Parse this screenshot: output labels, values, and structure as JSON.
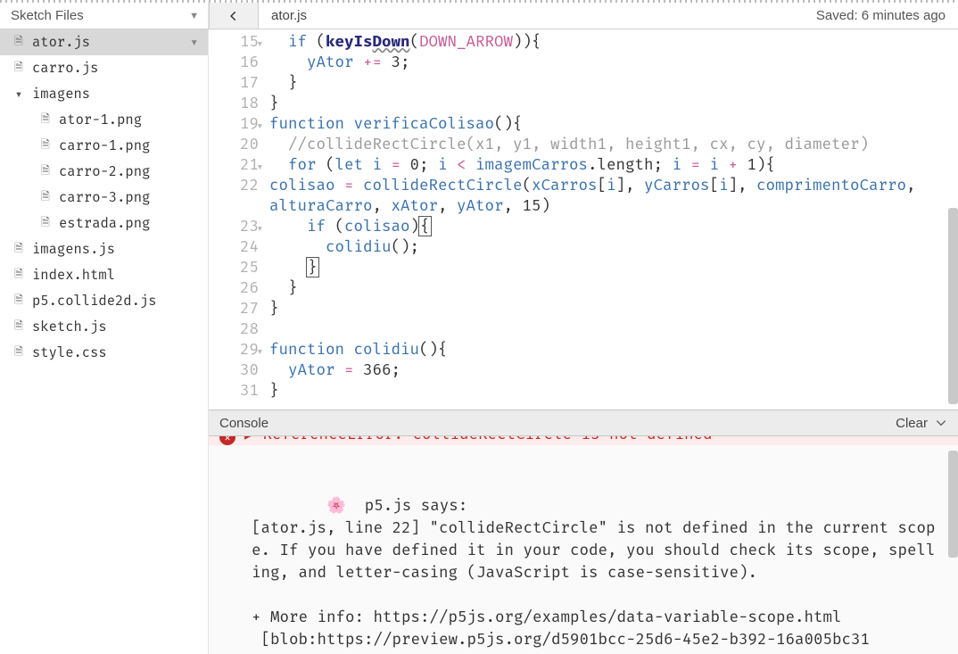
{
  "header": {
    "sketch_files_label": "Sketch Files",
    "current_tab": "ator.js",
    "saved_label": "Saved: 6 minutes ago"
  },
  "sidebar": {
    "files": [
      {
        "name": "ator.js",
        "type": "file",
        "indent": 0,
        "active": true,
        "chevron": true
      },
      {
        "name": "carro.js",
        "type": "file",
        "indent": 0
      },
      {
        "name": "imagens",
        "type": "folder-open",
        "indent": 0
      },
      {
        "name": "ator-1.png",
        "type": "file",
        "indent": 1
      },
      {
        "name": "carro-1.png",
        "type": "file",
        "indent": 1
      },
      {
        "name": "carro-2.png",
        "type": "file",
        "indent": 1
      },
      {
        "name": "carro-3.png",
        "type": "file",
        "indent": 1
      },
      {
        "name": "estrada.png",
        "type": "file",
        "indent": 1
      },
      {
        "name": "imagens.js",
        "type": "file",
        "indent": 0
      },
      {
        "name": "index.html",
        "type": "file",
        "indent": 0
      },
      {
        "name": "p5.collide2d.js",
        "type": "file",
        "indent": 0
      },
      {
        "name": "sketch.js",
        "type": "file",
        "indent": 0
      },
      {
        "name": "style.css",
        "type": "file",
        "indent": 0
      }
    ]
  },
  "editor": {
    "first_line": 15,
    "lines": [
      {
        "n": 15,
        "fold": true,
        "html": "  <span class='tok-kw'>if</span> (<span class='tok-bold'>keyIs</span><span class='tok-bold tok-under'>Down</span>(<span class='tok-pink'>DOWN_ARROW</span>)){"
      },
      {
        "n": 16,
        "html": "    <span class='tok-var'>yAtor</span> <span class='tok-op'>+=</span> <span class='tok-num'>3</span>;"
      },
      {
        "n": 17,
        "html": "  }"
      },
      {
        "n": 18,
        "html": "}"
      },
      {
        "n": 19,
        "fold": true,
        "html": "<span class='tok-kw'>function</span> <span class='tok-fn'>verificaColisao</span>(){"
      },
      {
        "n": 20,
        "html": "  <span class='tok-cmt'>//collideRectCircle(x1, y1, width1, height1, cx, cy, diameter)</span>"
      },
      {
        "n": 21,
        "fold": true,
        "html": "  <span class='tok-kw'>for</span> (<span class='tok-kw'>let</span> <span class='tok-var'>i</span> <span class='tok-op'>=</span> <span class='tok-num'>0</span>; <span class='tok-var'>i</span> <span class='tok-op'>&lt;</span> <span class='tok-var'>imagemCarros</span>.length; <span class='tok-var'>i</span> <span class='tok-op'>=</span> <span class='tok-var'>i</span> <span class='tok-op'>+</span> <span class='tok-num'>1</span>){"
      },
      {
        "n": 22,
        "html": "  <span class='tok-var'>colisao</span> <span class='tok-op'>=</span> <span class='tok-fn'>collideRectCircle</span>(<span class='tok-var'>xCarros</span>[<span class='tok-var'>i</span>], <span class='tok-var'>yCarros</span>[<span class='tok-var'>i</span>], <span class='tok-var'>comprimentoCarro</span>, <span class='tok-var'>alturaCarro</span>, <span class='tok-var'>xAtor</span>, <span class='tok-var'>yAtor</span>, <span class='tok-num'>15</span>)",
        "wrap": true
      },
      {
        "n": 23,
        "fold": true,
        "html": "    <span class='tok-kw'>if</span> (<span class='tok-var'>colisao</span>)<span class='cursor-box'>{</span>"
      },
      {
        "n": 24,
        "html": "      <span class='tok-fn'>colidiu</span>();"
      },
      {
        "n": 25,
        "html": "    <span class='cursor-box'>}</span>"
      },
      {
        "n": 26,
        "html": "  }"
      },
      {
        "n": 27,
        "html": "}"
      },
      {
        "n": 28,
        "html": ""
      },
      {
        "n": 29,
        "fold": true,
        "html": "<span class='tok-kw'>function</span> <span class='tok-fn'>colidiu</span>(){"
      },
      {
        "n": 30,
        "html": "  <span class='tok-var'>yAtor</span> <span class='tok-op'>=</span> <span class='tok-num'>366</span>;"
      },
      {
        "n": 31,
        "html": "}"
      }
    ]
  },
  "console": {
    "title": "Console",
    "clear_label": "Clear",
    "error_strip": "ReferenceError: collideRectCircle is not defined",
    "msg_intro": "p5.js says:",
    "msg_body": "[ator.js, line 22] \"collideRectCircle\" is not defined in the current scope. If you have defined it in your code, you should check its scope, spelling, and letter-casing (JavaScript is case-sensitive).",
    "msg_more": "+ More info: https://p5js.org/examples/data-variable-scope.html",
    "msg_blob": "[blob:https://preview.p5js.org/d5901bcc-25d6-45e2-b392-16a005bc31"
  }
}
